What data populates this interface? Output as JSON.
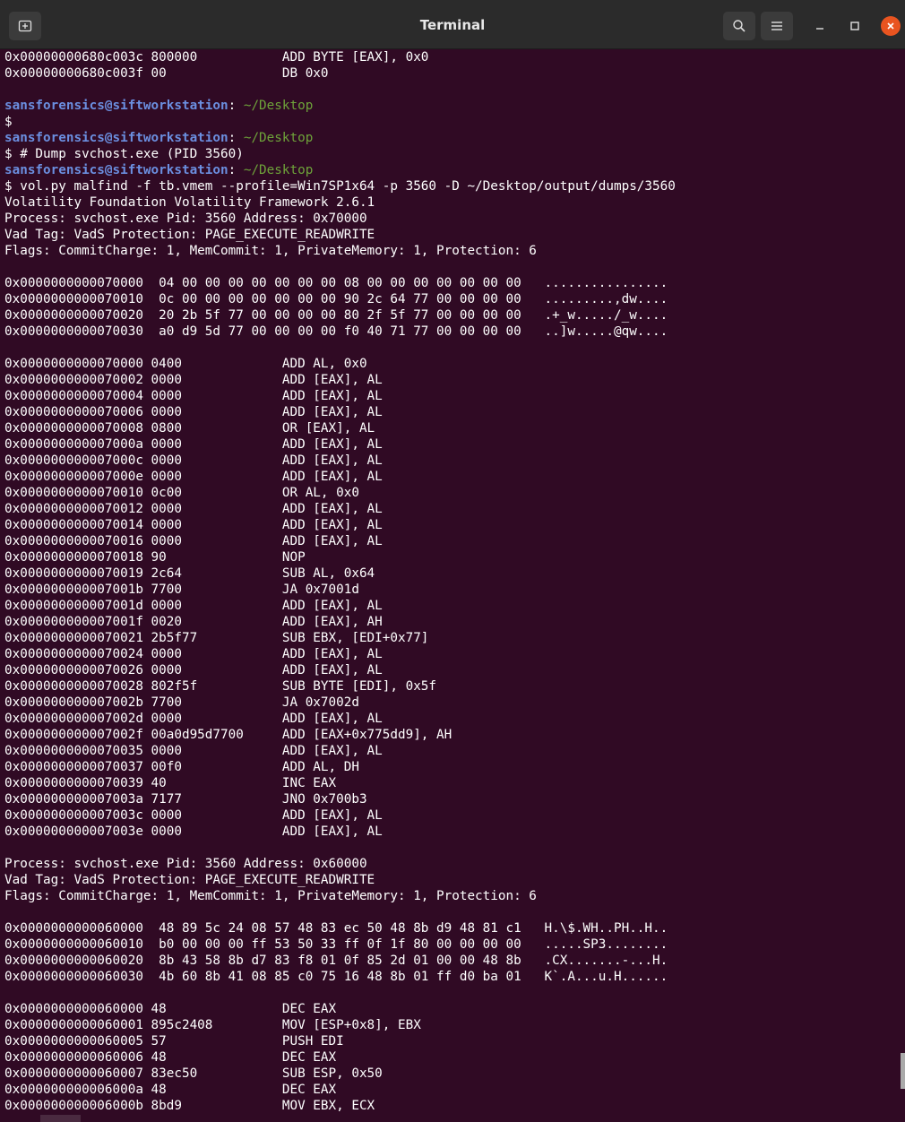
{
  "window": {
    "title": "Terminal",
    "buttons": {
      "new_tab": "⊞",
      "search": "⌕",
      "menu": "☰",
      "minimize": "–",
      "maximize": "□",
      "close": "✕"
    }
  },
  "prompt": {
    "user": "sansforensics@siftworkstation",
    "sep": ":",
    "path": " ~/Desktop"
  },
  "lines": [
    "0x00000000680c003c 800000           ADD BYTE [EAX], 0x0",
    "0x00000000680c003f 00               DB 0x0",
    "",
    "@PROMPT",
    "$",
    "@PROMPT",
    "$ # Dump svchost.exe (PID 3560)",
    "@PROMPT",
    "$ vol.py malfind -f tb.vmem --profile=Win7SP1x64 -p 3560 -D ~/Desktop/output/dumps/3560",
    "Volatility Foundation Volatility Framework 2.6.1",
    "Process: svchost.exe Pid: 3560 Address: 0x70000",
    "Vad Tag: VadS Protection: PAGE_EXECUTE_READWRITE",
    "Flags: CommitCharge: 1, MemCommit: 1, PrivateMemory: 1, Protection: 6",
    "",
    "0x0000000000070000  04 00 00 00 00 00 00 00 08 00 00 00 00 00 00 00   ................",
    "0x0000000000070010  0c 00 00 00 00 00 00 00 90 2c 64 77 00 00 00 00   .........,dw....",
    "0x0000000000070020  20 2b 5f 77 00 00 00 00 80 2f 5f 77 00 00 00 00   .+_w...../_w....",
    "0x0000000000070030  a0 d9 5d 77 00 00 00 00 f0 40 71 77 00 00 00 00   ..]w.....@qw....",
    "",
    "0x0000000000070000 0400             ADD AL, 0x0",
    "0x0000000000070002 0000             ADD [EAX], AL",
    "0x0000000000070004 0000             ADD [EAX], AL",
    "0x0000000000070006 0000             ADD [EAX], AL",
    "0x0000000000070008 0800             OR [EAX], AL",
    "0x000000000007000a 0000             ADD [EAX], AL",
    "0x000000000007000c 0000             ADD [EAX], AL",
    "0x000000000007000e 0000             ADD [EAX], AL",
    "0x0000000000070010 0c00             OR AL, 0x0",
    "0x0000000000070012 0000             ADD [EAX], AL",
    "0x0000000000070014 0000             ADD [EAX], AL",
    "0x0000000000070016 0000             ADD [EAX], AL",
    "0x0000000000070018 90               NOP",
    "0x0000000000070019 2c64             SUB AL, 0x64",
    "0x000000000007001b 7700             JA 0x7001d",
    "0x000000000007001d 0000             ADD [EAX], AL",
    "0x000000000007001f 0020             ADD [EAX], AH",
    "0x0000000000070021 2b5f77           SUB EBX, [EDI+0x77]",
    "0x0000000000070024 0000             ADD [EAX], AL",
    "0x0000000000070026 0000             ADD [EAX], AL",
    "0x0000000000070028 802f5f           SUB BYTE [EDI], 0x5f",
    "0x000000000007002b 7700             JA 0x7002d",
    "0x000000000007002d 0000             ADD [EAX], AL",
    "0x000000000007002f 00a0d95d7700     ADD [EAX+0x775dd9], AH",
    "0x0000000000070035 0000             ADD [EAX], AL",
    "0x0000000000070037 00f0             ADD AL, DH",
    "0x0000000000070039 40               INC EAX",
    "0x000000000007003a 7177             JNO 0x700b3",
    "0x000000000007003c 0000             ADD [EAX], AL",
    "0x000000000007003e 0000             ADD [EAX], AL",
    "",
    "Process: svchost.exe Pid: 3560 Address: 0x60000",
    "Vad Tag: VadS Protection: PAGE_EXECUTE_READWRITE",
    "Flags: CommitCharge: 1, MemCommit: 1, PrivateMemory: 1, Protection: 6",
    "",
    "0x0000000000060000  48 89 5c 24 08 57 48 83 ec 50 48 8b d9 48 81 c1   H.\\$.WH..PH..H..",
    "0x0000000000060010  b0 00 00 00 ff 53 50 33 ff 0f 1f 80 00 00 00 00   .....SP3........",
    "0x0000000000060020  8b 43 58 8b d7 83 f8 01 0f 85 2d 01 00 00 48 8b   .CX.......-...H.",
    "0x0000000000060030  4b 60 8b 41 08 85 c0 75 16 48 8b 01 ff d0 ba 01   K`.A...u.H......",
    "",
    "0x0000000000060000 48               DEC EAX",
    "0x0000000000060001 895c2408         MOV [ESP+0x8], EBX",
    "0x0000000000060005 57               PUSH EDI",
    "0x0000000000060006 48               DEC EAX",
    "0x0000000000060007 83ec50           SUB ESP, 0x50",
    "0x000000000006000a 48               DEC EAX",
    "0x000000000006000b 8bd9             MOV EBX, ECX"
  ]
}
